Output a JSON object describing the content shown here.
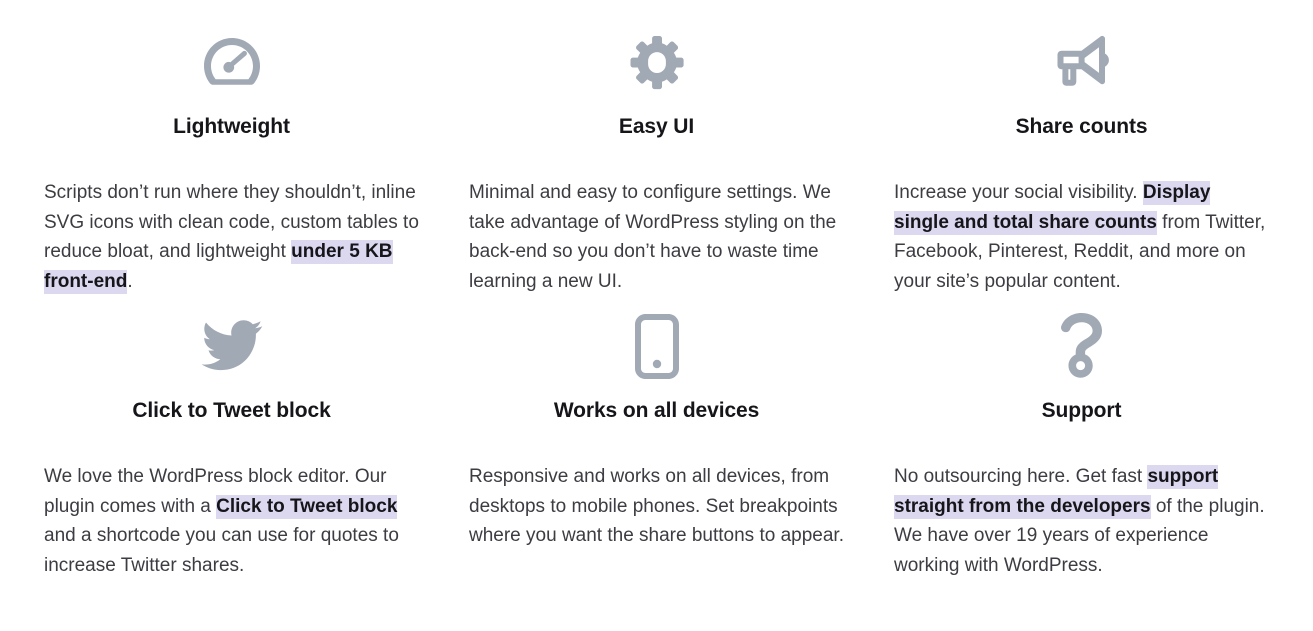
{
  "theme": {
    "page_background": "#ffffff",
    "icon_color": "#a1a9b5",
    "heading_color": "#16161a",
    "body_text_color": "#3c3c42",
    "highlight_background": "#dcd8f0"
  },
  "features": [
    {
      "icon": "speedometer-icon",
      "title": "Lightweight",
      "body": [
        {
          "text": "Scripts don’t run where they shouldn’t, inline SVG icons with clean code, custom tables to reduce bloat, and lightweight ",
          "highlight": false
        },
        {
          "text": "under 5 KB front-end",
          "highlight": true
        },
        {
          "text": ".",
          "highlight": false
        }
      ]
    },
    {
      "icon": "gear-icon",
      "title": "Easy UI",
      "body": [
        {
          "text": "Minimal and easy to configure settings. We take advantage of WordPress styling on the back-end so you don’t have to waste time learning a new UI.",
          "highlight": false
        }
      ]
    },
    {
      "icon": "megaphone-icon",
      "title": "Share counts",
      "body": [
        {
          "text": "Increase your social visibility. ",
          "highlight": false
        },
        {
          "text": "Display single and total share counts",
          "highlight": true
        },
        {
          "text": " from Twitter, Facebook, Pinterest, Reddit, and more on your site’s popular content.",
          "highlight": false
        }
      ]
    },
    {
      "icon": "twitter-bird-icon",
      "title": "Click to Tweet block",
      "body": [
        {
          "text": "We love the WordPress block editor. Our plugin comes with a ",
          "highlight": false
        },
        {
          "text": "Click to Tweet block",
          "highlight": true
        },
        {
          "text": " and a shortcode you can use for quotes to increase Twitter shares.",
          "highlight": false
        }
      ]
    },
    {
      "icon": "mobile-phone-icon",
      "title": "Works on all devices",
      "body": [
        {
          "text": "Responsive and works on all devices, from desktops to mobile phones. Set breakpoints where you want the share buttons to appear.",
          "highlight": false
        }
      ]
    },
    {
      "icon": "question-mark-icon",
      "title": "Support",
      "body": [
        {
          "text": "No outsourcing here. Get fast ",
          "highlight": false
        },
        {
          "text": "support straight from the developers",
          "highlight": true
        },
        {
          "text": " of the plugin. We have over 19 years of experience working with WordPress.",
          "highlight": false
        }
      ]
    }
  ]
}
